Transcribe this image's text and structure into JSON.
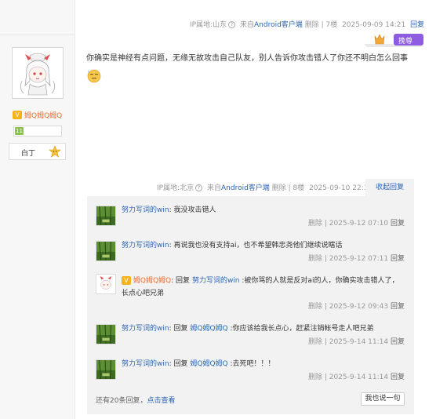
{
  "user": {
    "name": "姆Q姆Q姆Q",
    "rank_label": "白丁"
  },
  "top_meta": {
    "ip": "IP属地:山东",
    "source_prefix": "来自",
    "source": "Android客户端",
    "delete": "删除",
    "floor": "7楼",
    "time": "2025-09-09 14:21",
    "reply": "回复"
  },
  "badge": {
    "label": "挽尊"
  },
  "post": {
    "text": "你确实是神经有点问题，无缘无故攻击自己队友，别人告诉你攻击错人了你还不明白怎么回事"
  },
  "mid_meta": {
    "ip": "IP属地:北京",
    "source_prefix": "来自",
    "source": "Android客户端",
    "delete": "删除",
    "floor": "8楼",
    "time": "2025-09-10 22:17",
    "collapse": "收起回复"
  },
  "replies": [
    {
      "user": "努力写词的win",
      "reply_word": "",
      "target": "",
      "text": "我没攻击错人",
      "meta_prefix": "删除 | 2025-9-12 07:10",
      "reply": "回复"
    },
    {
      "user": "努力写词的win",
      "reply_word": "",
      "target": "",
      "text": "再说我也没有支持ai，也不希望韩忠尧他们继续说瞎话",
      "meta_prefix": "删除 | 2025-9-12 07:11",
      "reply": "回复"
    },
    {
      "user": "姆Q姆Q姆Q",
      "reply_word": "回复",
      "target": "努力写词的win",
      "text": ":被你骂的人就是反对ai的人，你确实攻击错人了，长点心吧兄弟",
      "meta_prefix": "删除 | 2025-9-12 09:43",
      "reply": "回复"
    },
    {
      "user": "努力写词的win",
      "reply_word": "回复",
      "target": "姆Q姆Q姆Q",
      "text": ":你应该给我长点心，赶紧注销帐号走人吧兄弟",
      "meta_prefix": "删除 | 2025-9-14 11:14",
      "reply": "回复"
    },
    {
      "user": "努力写词的win",
      "reply_word": "回复",
      "target": "姆Q姆Q姆Q",
      "text": ":去死吧！！！",
      "meta_prefix": "删除 | 2025-9-14 11:14",
      "reply": "回复"
    }
  ],
  "more": {
    "prefix": "还有20条回复，",
    "link": "点击查看"
  },
  "say_button": "我也说一句"
}
